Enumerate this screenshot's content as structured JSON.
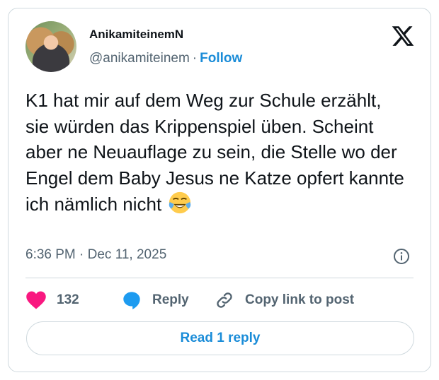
{
  "author": {
    "display_name": "AnikamiteinemN",
    "handle": "@anikamiteinem",
    "separator": "·",
    "follow_label": "Follow"
  },
  "brand": {
    "logo_icon": "x-logo-icon",
    "color": "#0f1419"
  },
  "tweet": {
    "text": "K1 hat mir auf dem Weg zur Schule erzählt, sie würden das Krippenspiel üben. Scheint aber ne Neuauflage zu sein, die Stelle wo der Engel dem Baby Jesus ne Katze opfert kannte ich nämlich nicht",
    "emoji_icon": "face-with-tears-of-joy-icon",
    "timestamp": "6:36 PM · Dec 11, 2025"
  },
  "actions": {
    "like_count": "132",
    "reply_label": "Reply",
    "copy_label": "Copy link to post"
  },
  "read_replies_label": "Read 1 reply",
  "colors": {
    "accent": "#1a8cd8",
    "like": "#f91880",
    "reply_bubble": "#1d9bf0",
    "muted": "#536471",
    "border": "#cfd9de"
  }
}
